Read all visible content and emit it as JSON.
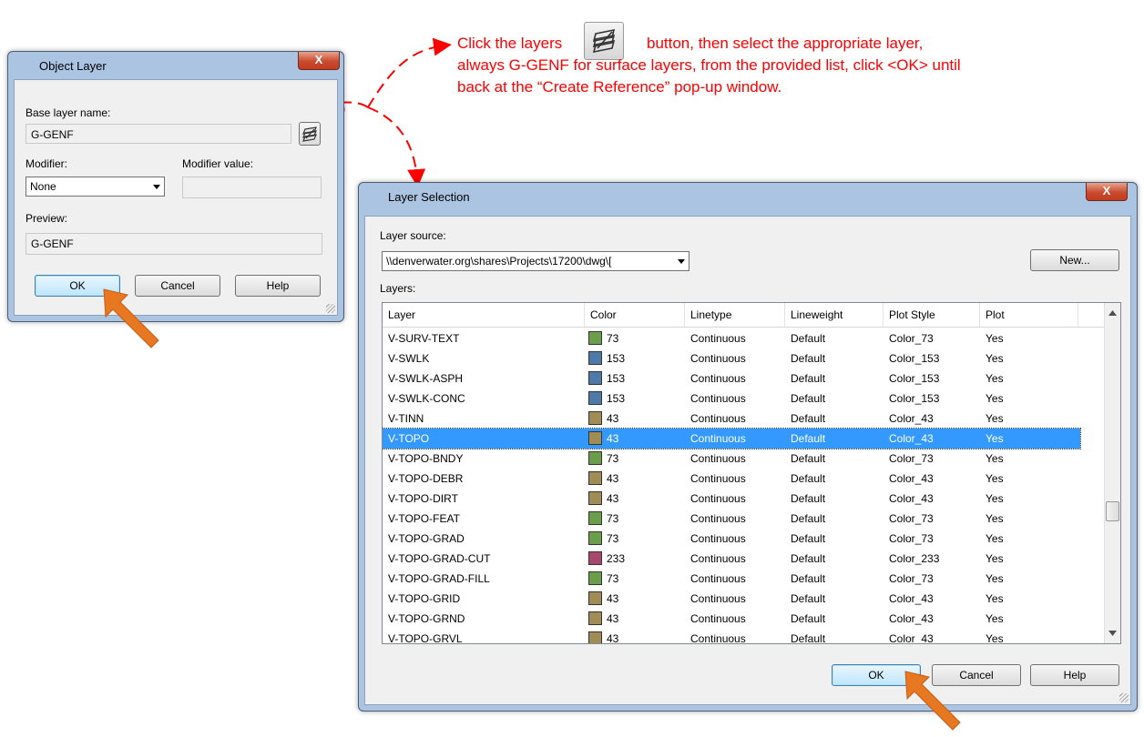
{
  "annotation": {
    "text_before": "Click the layers",
    "text_after": "button, then select the appropriate layer, always G-GENF for surface layers, from the provided list, click <OK> until back at the “Create Reference” pop-up window."
  },
  "object_layer": {
    "title": "Object Layer",
    "close": "X",
    "base_layer_label": "Base layer name:",
    "base_layer_value": "G-GENF",
    "modifier_label": "Modifier:",
    "modifier_value": "None",
    "modifier_value_label": "Modifier value:",
    "modifier_value_text": "",
    "preview_label": "Preview:",
    "preview_value": "G-GENF",
    "ok": "OK",
    "cancel": "Cancel",
    "help": "Help"
  },
  "layer_selection": {
    "title": "Layer Selection",
    "close": "X",
    "source_label": "Layer source:",
    "source_value": "\\\\denverwater.org\\shares\\Projects\\17200\\dwg\\[",
    "new_button": "New...",
    "layers_label": "Layers:",
    "columns": [
      "Layer",
      "Color",
      "Linetype",
      "Lineweight",
      "Plot Style",
      "Plot"
    ],
    "selected_index": 5,
    "rows": [
      {
        "layer": "V-SURV-TEXT",
        "color": "73",
        "swatch": "#6a9e4a",
        "linetype": "Continuous",
        "lineweight": "Default",
        "plotstyle": "Color_73",
        "plot": "Yes"
      },
      {
        "layer": "V-SWLK",
        "color": "153",
        "swatch": "#4d7aa6",
        "linetype": "Continuous",
        "lineweight": "Default",
        "plotstyle": "Color_153",
        "plot": "Yes"
      },
      {
        "layer": "V-SWLK-ASPH",
        "color": "153",
        "swatch": "#4d7aa6",
        "linetype": "Continuous",
        "lineweight": "Default",
        "plotstyle": "Color_153",
        "plot": "Yes"
      },
      {
        "layer": "V-SWLK-CONC",
        "color": "153",
        "swatch": "#4d7aa6",
        "linetype": "Continuous",
        "lineweight": "Default",
        "plotstyle": "Color_153",
        "plot": "Yes"
      },
      {
        "layer": "V-TINN",
        "color": "43",
        "swatch": "#a08d55",
        "linetype": "Continuous",
        "lineweight": "Default",
        "plotstyle": "Color_43",
        "plot": "Yes"
      },
      {
        "layer": "V-TOPO",
        "color": "43",
        "swatch": "#a08d55",
        "linetype": "Continuous",
        "lineweight": "Default",
        "plotstyle": "Color_43",
        "plot": "Yes"
      },
      {
        "layer": "V-TOPO-BNDY",
        "color": "73",
        "swatch": "#6a9e4a",
        "linetype": "Continuous",
        "lineweight": "Default",
        "plotstyle": "Color_73",
        "plot": "Yes"
      },
      {
        "layer": "V-TOPO-DEBR",
        "color": "43",
        "swatch": "#a08d55",
        "linetype": "Continuous",
        "lineweight": "Default",
        "plotstyle": "Color_43",
        "plot": "Yes"
      },
      {
        "layer": "V-TOPO-DIRT",
        "color": "43",
        "swatch": "#a08d55",
        "linetype": "Continuous",
        "lineweight": "Default",
        "plotstyle": "Color_43",
        "plot": "Yes"
      },
      {
        "layer": "V-TOPO-FEAT",
        "color": "73",
        "swatch": "#6a9e4a",
        "linetype": "Continuous",
        "lineweight": "Default",
        "plotstyle": "Color_73",
        "plot": "Yes"
      },
      {
        "layer": "V-TOPO-GRAD",
        "color": "73",
        "swatch": "#6a9e4a",
        "linetype": "Continuous",
        "lineweight": "Default",
        "plotstyle": "Color_73",
        "plot": "Yes"
      },
      {
        "layer": "V-TOPO-GRAD-CUT",
        "color": "233",
        "swatch": "#a8486e",
        "linetype": "Continuous",
        "lineweight": "Default",
        "plotstyle": "Color_233",
        "plot": "Yes"
      },
      {
        "layer": "V-TOPO-GRAD-FILL",
        "color": "73",
        "swatch": "#6a9e4a",
        "linetype": "Continuous",
        "lineweight": "Default",
        "plotstyle": "Color_73",
        "plot": "Yes"
      },
      {
        "layer": "V-TOPO-GRID",
        "color": "43",
        "swatch": "#a08d55",
        "linetype": "Continuous",
        "lineweight": "Default",
        "plotstyle": "Color_43",
        "plot": "Yes"
      },
      {
        "layer": "V-TOPO-GRND",
        "color": "43",
        "swatch": "#a08d55",
        "linetype": "Continuous",
        "lineweight": "Default",
        "plotstyle": "Color_43",
        "plot": "Yes"
      },
      {
        "layer": "V-TOPO-GRVL",
        "color": "43",
        "swatch": "#a08d55",
        "linetype": "Continuous",
        "lineweight": "Default",
        "plotstyle": "Color_43",
        "plot": "Yes"
      }
    ],
    "ok": "OK",
    "cancel": "Cancel",
    "help": "Help"
  },
  "colors": {
    "annotation_red": "#ff0000",
    "arrow_orange": "#e87722",
    "selection_blue": "#3399ff"
  }
}
